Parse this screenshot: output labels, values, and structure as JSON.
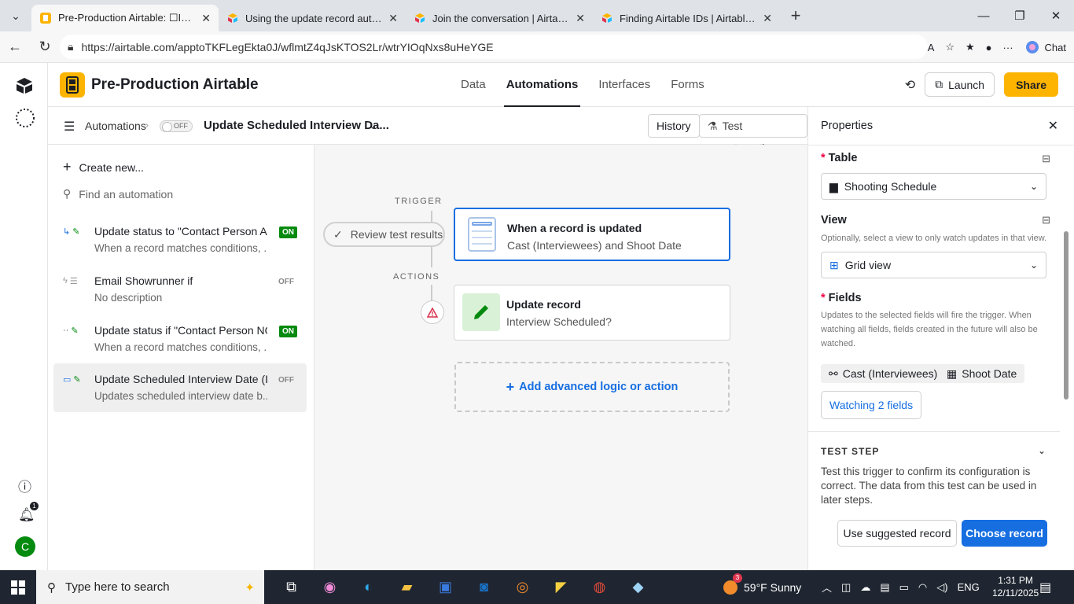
{
  "browser": {
    "tabs": [
      {
        "title": "Pre-Production Airtable: ☐Intervie",
        "active": true
      },
      {
        "title": "Using the update record automati",
        "active": false
      },
      {
        "title": "Join the conversation | Airtable Co",
        "active": false
      },
      {
        "title": "Finding Airtable IDs | Airtable Supp",
        "active": false
      }
    ],
    "url": "https://airtable.com/apptoTKFLegEkta0J/wflmtZ4qJsKTOS2Lr/wtrYIOqNxs8uHeYGE",
    "chat_label": "Chat"
  },
  "rail": {
    "help_badge": "1",
    "avatar_letter": "C"
  },
  "header": {
    "base_name": "Pre-Production Airtable",
    "nav": [
      "Data",
      "Automations",
      "Interfaces",
      "Forms"
    ],
    "launch": "Launch",
    "share": "Share"
  },
  "toolbar": {
    "breadcrumb": "Automations",
    "toggle": "OFF",
    "automation_title": "Update Scheduled Interview Da...",
    "history": "History",
    "test_automation": "Test automation"
  },
  "sidebar": {
    "create_new": "Create new...",
    "find_placeholder": "Find an automation",
    "items": [
      {
        "name": "Update status to \"Contact Person As...",
        "desc": "When a record matches conditions, ...",
        "status": "ON"
      },
      {
        "name": "Email Showrunner if",
        "desc": "No description",
        "status": "OFF"
      },
      {
        "name": "Update status if \"Contact Person NO...",
        "desc": "When a record matches conditions, ...",
        "status": "ON"
      },
      {
        "name": "Update Scheduled Interview Date (I...",
        "desc": "Updates scheduled interview date b...",
        "status": "OFF"
      }
    ]
  },
  "canvas": {
    "trigger_label": "TRIGGER",
    "actions_label": "ACTIONS",
    "review_test": "Review test results",
    "trigger_card": {
      "title": "When a record is updated",
      "sub": "Cast (Interviewees) and Shoot Date"
    },
    "action_card": {
      "title": "Update record",
      "sub": "Interview Scheduled?"
    },
    "add_logic": "Add advanced logic or action"
  },
  "properties": {
    "title": "Properties",
    "table_label": "Table",
    "table_value": "Shooting Schedule",
    "view_label": "View",
    "view_help": "Optionally, select a view to only watch updates in that view.",
    "view_value": "Grid view",
    "fields_label": "Fields",
    "fields_help": "Updates to the selected fields will fire the trigger. When watching all fields, fields created in the future will also be watched.",
    "field_chips": [
      "Cast (Interviewees)",
      "Shoot Date"
    ],
    "watching": "Watching 2 fields",
    "test_step": "TEST STEP",
    "test_step_text": "Test this trigger to confirm its configuration is correct. The data from this test can be used in later steps.",
    "use_suggested": "Use suggested record",
    "choose_record": "Choose record"
  },
  "taskbar": {
    "search": "Type here to search",
    "weather_badge": "3",
    "weather": "59°F  Sunny",
    "lang": "ENG",
    "time": "1:31 PM",
    "date": "12/11/2025",
    "notif_badge": "1"
  },
  "colors": {
    "accent_blue": "#166ee1",
    "base_yellow": "#fcb400",
    "on_green": "#048a0e"
  }
}
